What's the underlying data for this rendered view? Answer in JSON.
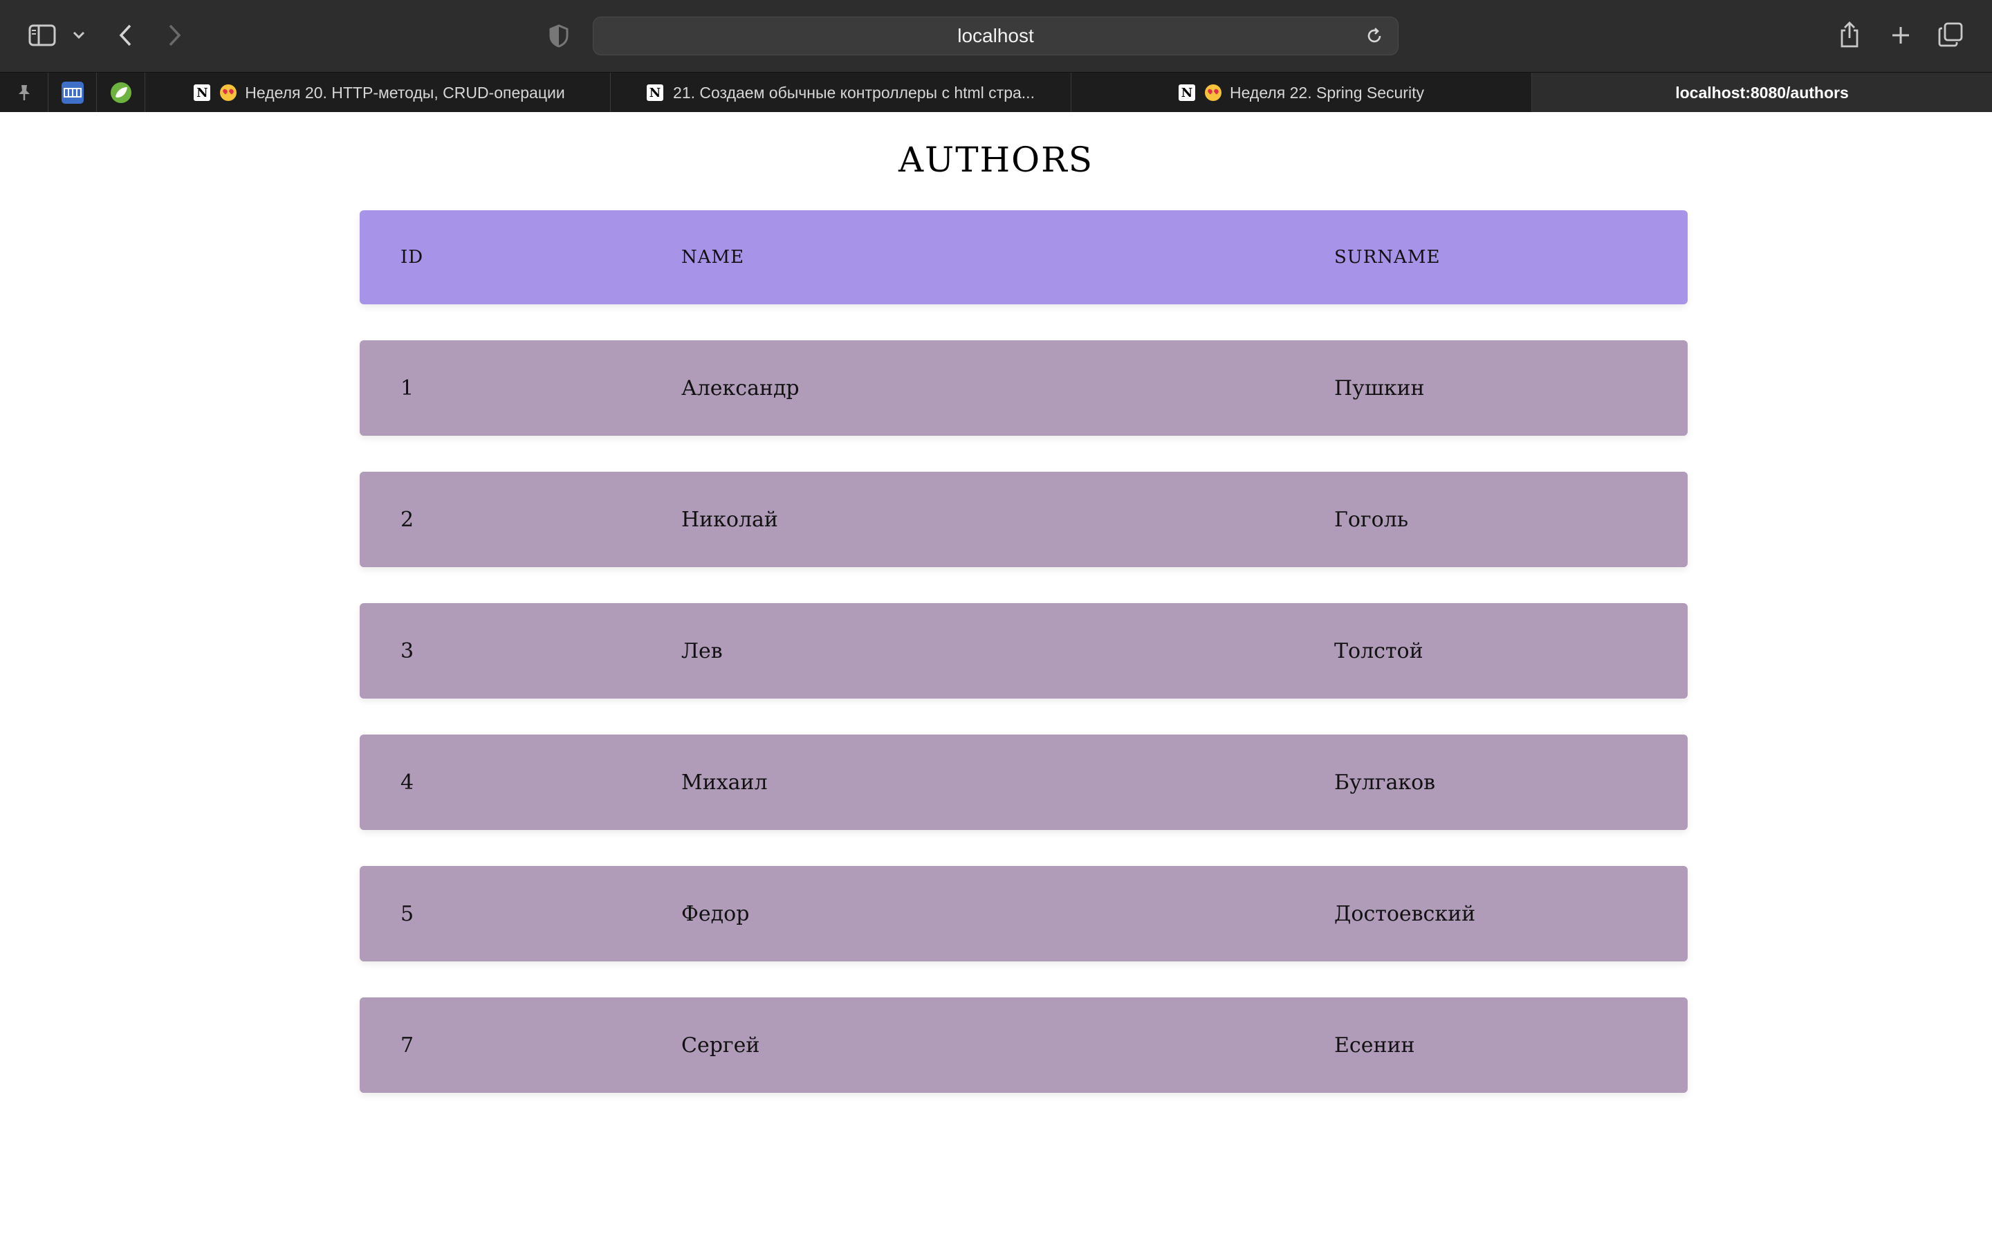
{
  "browser": {
    "url": "localhost",
    "tabs": [
      {
        "label": "Неделя 20. HTTP-методы, CRUD-операции",
        "active": false
      },
      {
        "label": "21. Создаем обычные контроллеры с html стра...",
        "active": false
      },
      {
        "label": "Неделя 22. Spring Security",
        "active": false
      },
      {
        "label": "localhost:8080/authors",
        "active": true
      }
    ],
    "pinned": [
      "pin-icon",
      "mvn-icon",
      "spring-icon"
    ]
  },
  "page": {
    "title": "Authors",
    "columns": {
      "id": "ID",
      "name": "Name",
      "surname": "Surname"
    },
    "rows": [
      {
        "id": "1",
        "name": "Александр",
        "surname": "Пушкин"
      },
      {
        "id": "2",
        "name": "Николай",
        "surname": "Гоголь"
      },
      {
        "id": "3",
        "name": "Лев",
        "surname": "Толстой"
      },
      {
        "id": "4",
        "name": "Михаил",
        "surname": "Булгаков"
      },
      {
        "id": "5",
        "name": "Федор",
        "surname": "Достоевский"
      },
      {
        "id": "7",
        "name": "Сергей",
        "surname": "Есенин"
      }
    ]
  },
  "colors": {
    "header_row": "#a794e8",
    "data_row": "#b09bb8",
    "toolbar": "#2d2d2d"
  }
}
